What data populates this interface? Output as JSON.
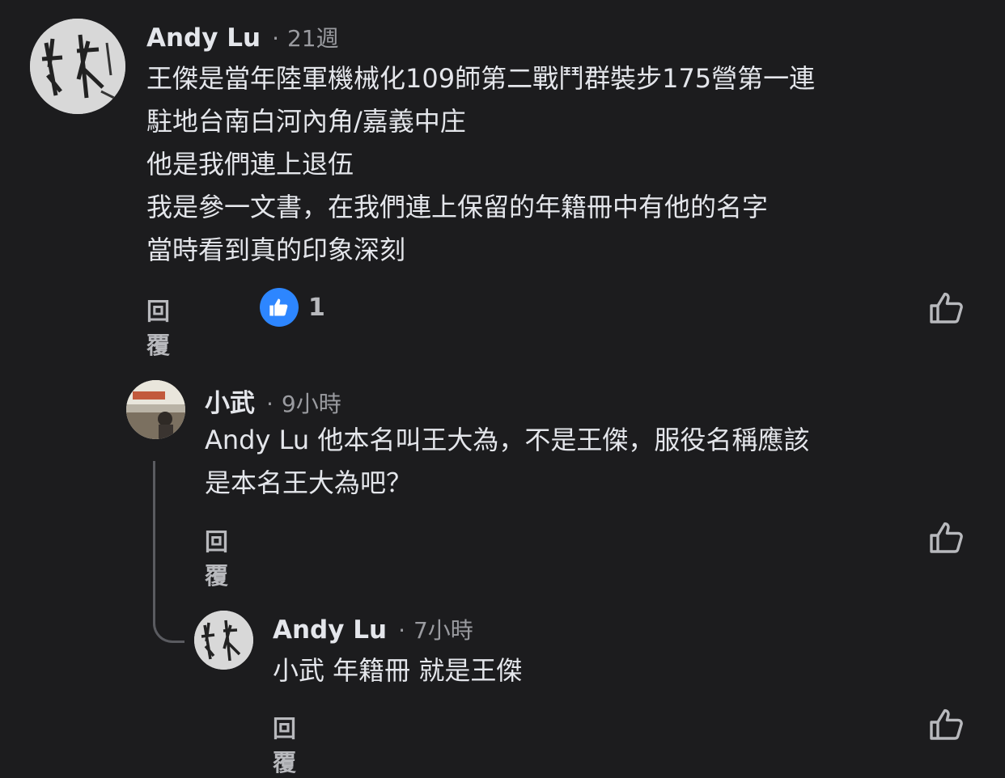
{
  "comments": [
    {
      "author": "Andy Lu",
      "separator": "·",
      "time": "21週",
      "lines": [
        "王傑是當年陸軍機械化109師第二戰鬥群裝步175營第一連",
        "駐地台南白河內角/嘉義中庄",
        "他是我們連上退伍",
        "我是參一文書，在我們連上保留的年籍冊中有他的名字",
        "當時看到真的印象深刻"
      ],
      "reply_label": "回覆",
      "reaction_icon": "like-icon",
      "reaction_count": "1",
      "like_icon": "thumbs-up-outline-icon"
    },
    {
      "author": "小武",
      "separator": "·",
      "time": "9小時",
      "lines": [
        "Andy Lu 他本名叫王大為，不是王傑，服役名稱應該",
        "是本名王大為吧？"
      ],
      "reply_label": "回覆",
      "like_icon": "thumbs-up-outline-icon"
    },
    {
      "author": "Andy Lu",
      "separator": "·",
      "time": "7小時",
      "lines": [
        "小武 年籍冊 就是王傑"
      ],
      "reply_label": "回覆",
      "like_icon": "thumbs-up-outline-icon"
    }
  ],
  "colors": {
    "background": "#1c1c1e",
    "text": "#e4e6eb",
    "secondary": "#9a9ba0",
    "like_blue": "#2d86ff"
  }
}
